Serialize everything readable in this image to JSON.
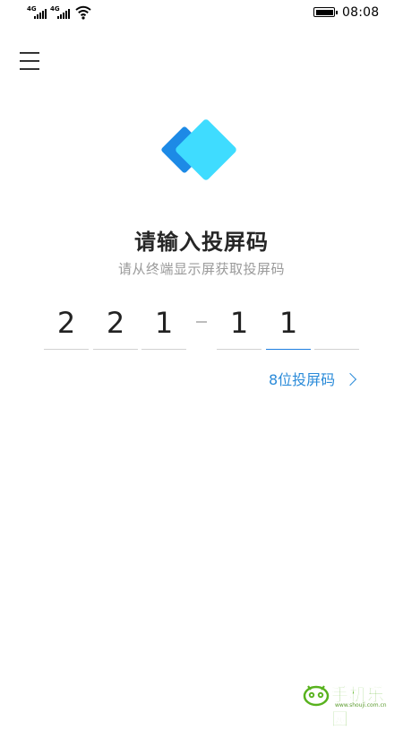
{
  "status_bar": {
    "network_1": "4G",
    "network_2": "4G",
    "time": "08:08"
  },
  "header": {
    "menu_icon": "menu-icon"
  },
  "logo": {
    "icon": "screen-cast-logo",
    "colors": {
      "back": "#1d8ae6",
      "front": "#3fdcff"
    }
  },
  "title": "请输入投屏码",
  "subtitle": "请从终端显示屏获取投屏码",
  "code": {
    "digits": [
      "2",
      "2",
      "1",
      "1",
      "1",
      ""
    ],
    "active_index": 4,
    "accent_color": "#1f7fe0"
  },
  "digits_link": {
    "label": "8位投屏码",
    "icon": "chevron-right-icon"
  },
  "watermark": {
    "text": "手机乐园",
    "url": "www.shouji.com.cn"
  }
}
